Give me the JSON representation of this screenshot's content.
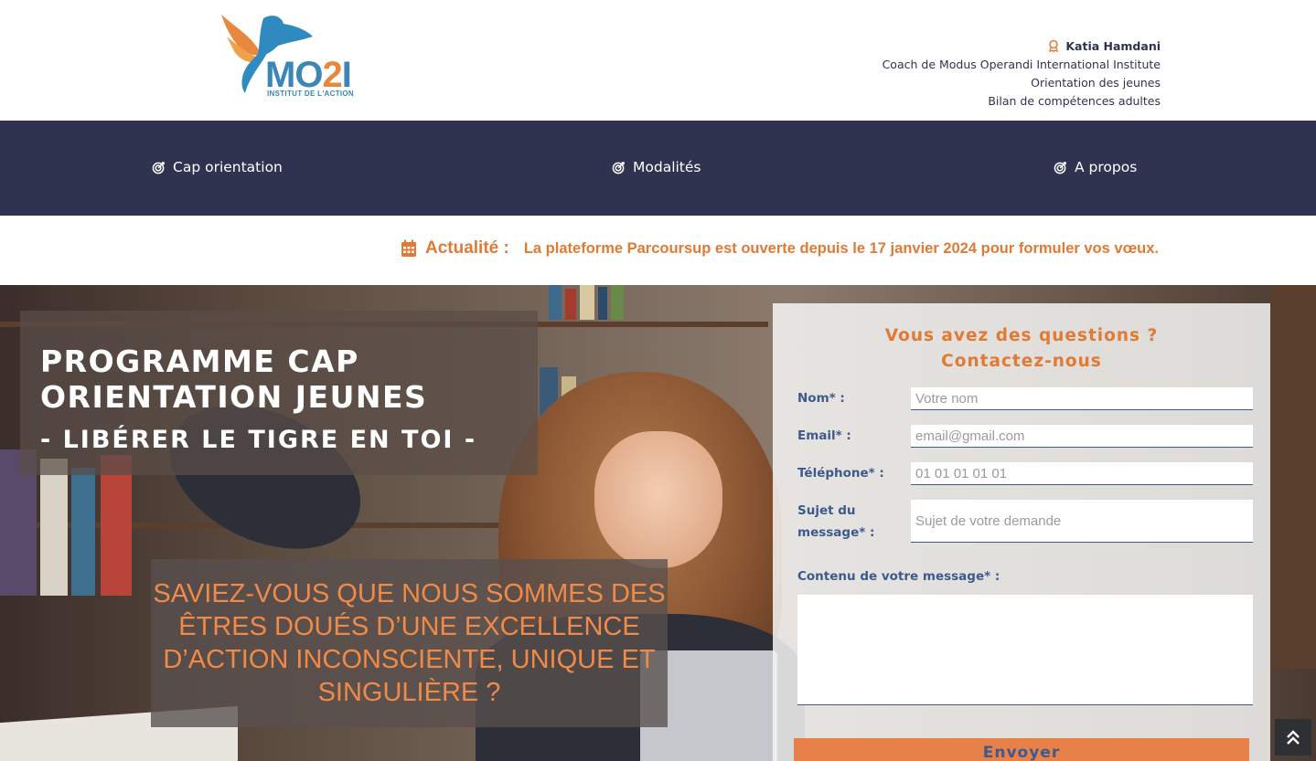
{
  "header": {
    "logo": {
      "mark": "MO",
      "mark_accent": "2",
      "mark_end": "I",
      "subtitle": "INSTITUT DE L'ACTION"
    },
    "coach": {
      "name": "Katia Hamdani",
      "line1": "Coach de Modus Operandi International Institute",
      "line2": "Orientation des jeunes",
      "line3": "Bilan de compétences adultes",
      "icon": "award-icon"
    }
  },
  "nav": {
    "items": [
      {
        "label": "Cap orientation",
        "icon": "target-icon"
      },
      {
        "label": "Modalités",
        "icon": "target-icon"
      },
      {
        "label": "A propos",
        "icon": "target-icon"
      }
    ]
  },
  "news": {
    "label": "Actualité :",
    "text": "La plateforme Parcoursup est ouverte depuis le 17 janvier 2024 pour formuler vos vœux.",
    "icon": "calendar-icon"
  },
  "hero": {
    "title_line1": "PROGRAMME CAP",
    "title_line2": "ORIENTATION JEUNES",
    "subtitle": "- LIBÉRER LE TIGRE EN TOI -",
    "question": "SAVIEZ-VOUS QUE NOUS SOMMES DES ÊTRES DOUÉS D’UNE EXCELLENCE D’ACTION INCONSCIENTE, UNIQUE ET SINGULIÈRE ?"
  },
  "form": {
    "title_line1": "Vous avez des questions ?",
    "title_line2": "Contactez-nous",
    "name_label": "Nom* :",
    "name_placeholder": "Votre nom",
    "email_label": "Email* :",
    "email_placeholder": "email@gmail.com",
    "phone_label": "Téléphone* :",
    "phone_placeholder": "01 01 01 01 01",
    "subject_label_1": "Sujet du",
    "subject_label_2": "message* :",
    "subject_placeholder": "Sujet de votre demande",
    "message_label": "Contenu de votre message* :",
    "submit_label": "Envoyer"
  },
  "colors": {
    "navy": "#2f3350",
    "orange": "#e07a35",
    "blue_label": "#3d5a8c"
  },
  "scroll_top": {
    "icon": "double-chevron-up-icon"
  }
}
